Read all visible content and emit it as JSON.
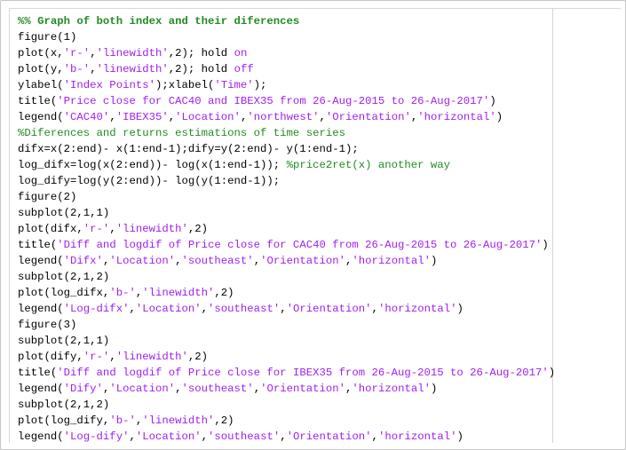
{
  "colors": {
    "plain": "#000000",
    "string": "#a020f0",
    "comment": "#228b22",
    "keyword": "#a020f0"
  },
  "lines": [
    [
      {
        "t": "cell",
        "v": "%% Graph of both index and their diferences"
      }
    ],
    [
      {
        "t": "plain",
        "v": "figure(1)"
      }
    ],
    [
      {
        "t": "plain",
        "v": "plot(x,"
      },
      {
        "t": "str",
        "v": "'r-'"
      },
      {
        "t": "plain",
        "v": ","
      },
      {
        "t": "str",
        "v": "'linewidth'"
      },
      {
        "t": "plain",
        "v": ",2); hold "
      },
      {
        "t": "kw",
        "v": "on"
      }
    ],
    [
      {
        "t": "plain",
        "v": "plot(y,"
      },
      {
        "t": "str",
        "v": "'b-'"
      },
      {
        "t": "plain",
        "v": ","
      },
      {
        "t": "str",
        "v": "'linewidth'"
      },
      {
        "t": "plain",
        "v": ",2); hold "
      },
      {
        "t": "kw",
        "v": "off"
      }
    ],
    [
      {
        "t": "plain",
        "v": "ylabel("
      },
      {
        "t": "str",
        "v": "'Index Points'"
      },
      {
        "t": "plain",
        "v": ");xlabel("
      },
      {
        "t": "str",
        "v": "'Time'"
      },
      {
        "t": "plain",
        "v": ");"
      }
    ],
    [
      {
        "t": "plain",
        "v": "title("
      },
      {
        "t": "str",
        "v": "'Price close for CAC40 and IBEX35 from 26-Aug-2015 to 26-Aug-2017'"
      },
      {
        "t": "plain",
        "v": ")"
      }
    ],
    [
      {
        "t": "plain",
        "v": "legend("
      },
      {
        "t": "str",
        "v": "'CAC40'"
      },
      {
        "t": "plain",
        "v": ","
      },
      {
        "t": "str",
        "v": "'IBEX35'"
      },
      {
        "t": "plain",
        "v": ","
      },
      {
        "t": "str",
        "v": "'Location'"
      },
      {
        "t": "plain",
        "v": ","
      },
      {
        "t": "str",
        "v": "'northwest'"
      },
      {
        "t": "plain",
        "v": ","
      },
      {
        "t": "str",
        "v": "'Orientation'"
      },
      {
        "t": "plain",
        "v": ","
      },
      {
        "t": "str",
        "v": "'horizontal'"
      },
      {
        "t": "plain",
        "v": ")"
      }
    ],
    [
      {
        "t": "com",
        "v": "%Diferences and returns estimations of time series"
      }
    ],
    [
      {
        "t": "plain",
        "v": "difx=x(2:end)- x(1:end-1);dify=y(2:end)- y(1:end-1);"
      }
    ],
    [
      {
        "t": "plain",
        "v": "log_difx=log(x(2:end))- log(x(1:end-1)); "
      },
      {
        "t": "com",
        "v": "%price2ret(x) another way"
      }
    ],
    [
      {
        "t": "plain",
        "v": "log_dify=log(y(2:end))- log(y(1:end-1));"
      }
    ],
    [
      {
        "t": "plain",
        "v": "figure(2)"
      }
    ],
    [
      {
        "t": "plain",
        "v": "subplot(2,1,1)"
      }
    ],
    [
      {
        "t": "plain",
        "v": "plot(difx,"
      },
      {
        "t": "str",
        "v": "'r-'"
      },
      {
        "t": "plain",
        "v": ","
      },
      {
        "t": "str",
        "v": "'linewidth'"
      },
      {
        "t": "plain",
        "v": ",2)"
      }
    ],
    [
      {
        "t": "plain",
        "v": "title("
      },
      {
        "t": "str",
        "v": "'Diff and logdif of Price close for CAC40 from 26-Aug-2015 to 26-Aug-2017'"
      },
      {
        "t": "plain",
        "v": ")"
      }
    ],
    [
      {
        "t": "plain",
        "v": "legend("
      },
      {
        "t": "str",
        "v": "'Difx'"
      },
      {
        "t": "plain",
        "v": ","
      },
      {
        "t": "str",
        "v": "'Location'"
      },
      {
        "t": "plain",
        "v": ","
      },
      {
        "t": "str",
        "v": "'southeast'"
      },
      {
        "t": "plain",
        "v": ","
      },
      {
        "t": "str",
        "v": "'Orientation'"
      },
      {
        "t": "plain",
        "v": ","
      },
      {
        "t": "str",
        "v": "'horizontal'"
      },
      {
        "t": "plain",
        "v": ")"
      }
    ],
    [
      {
        "t": "plain",
        "v": "subplot(2,1,2)"
      }
    ],
    [
      {
        "t": "plain",
        "v": "plot(log_difx,"
      },
      {
        "t": "str",
        "v": "'b-'"
      },
      {
        "t": "plain",
        "v": ","
      },
      {
        "t": "str",
        "v": "'linewidth'"
      },
      {
        "t": "plain",
        "v": ",2)"
      }
    ],
    [
      {
        "t": "plain",
        "v": "legend("
      },
      {
        "t": "str",
        "v": "'Log-difx'"
      },
      {
        "t": "plain",
        "v": ","
      },
      {
        "t": "str",
        "v": "'Location'"
      },
      {
        "t": "plain",
        "v": ","
      },
      {
        "t": "str",
        "v": "'southeast'"
      },
      {
        "t": "plain",
        "v": ","
      },
      {
        "t": "str",
        "v": "'Orientation'"
      },
      {
        "t": "plain",
        "v": ","
      },
      {
        "t": "str",
        "v": "'horizontal'"
      },
      {
        "t": "plain",
        "v": ")"
      }
    ],
    [
      {
        "t": "plain",
        "v": "figure(3)"
      }
    ],
    [
      {
        "t": "plain",
        "v": "subplot(2,1,1)"
      }
    ],
    [
      {
        "t": "plain",
        "v": "plot(dify,"
      },
      {
        "t": "str",
        "v": "'r-'"
      },
      {
        "t": "plain",
        "v": ","
      },
      {
        "t": "str",
        "v": "'linewidth'"
      },
      {
        "t": "plain",
        "v": ",2)"
      }
    ],
    [
      {
        "t": "plain",
        "v": "title("
      },
      {
        "t": "str",
        "v": "'Diff and logdif of Price close for IBEX35 from 26-Aug-2015 to 26-Aug-2017'"
      },
      {
        "t": "plain",
        "v": ")"
      }
    ],
    [
      {
        "t": "plain",
        "v": "legend("
      },
      {
        "t": "str",
        "v": "'Dify'"
      },
      {
        "t": "plain",
        "v": ","
      },
      {
        "t": "str",
        "v": "'Location'"
      },
      {
        "t": "plain",
        "v": ","
      },
      {
        "t": "str",
        "v": "'southeast'"
      },
      {
        "t": "plain",
        "v": ","
      },
      {
        "t": "str",
        "v": "'Orientation'"
      },
      {
        "t": "plain",
        "v": ","
      },
      {
        "t": "str",
        "v": "'horizontal'"
      },
      {
        "t": "plain",
        "v": ")"
      }
    ],
    [
      {
        "t": "plain",
        "v": "subplot(2,1,2)"
      }
    ],
    [
      {
        "t": "plain",
        "v": "plot(log_dify,"
      },
      {
        "t": "str",
        "v": "'b-'"
      },
      {
        "t": "plain",
        "v": ","
      },
      {
        "t": "str",
        "v": "'linewidth'"
      },
      {
        "t": "plain",
        "v": ",2)"
      }
    ],
    [
      {
        "t": "plain",
        "v": "legend("
      },
      {
        "t": "str",
        "v": "'Log-dify'"
      },
      {
        "t": "plain",
        "v": ","
      },
      {
        "t": "str",
        "v": "'Location'"
      },
      {
        "t": "plain",
        "v": ","
      },
      {
        "t": "str",
        "v": "'southeast'"
      },
      {
        "t": "plain",
        "v": ","
      },
      {
        "t": "str",
        "v": "'Orientation'"
      },
      {
        "t": "plain",
        "v": ","
      },
      {
        "t": "str",
        "v": "'horizontal'"
      },
      {
        "t": "plain",
        "v": ")"
      }
    ]
  ]
}
